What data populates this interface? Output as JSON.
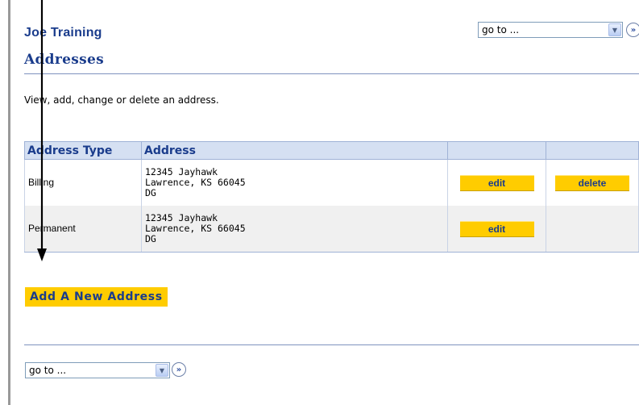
{
  "header": {
    "student_name": "Joe Training",
    "page_title": "Addresses"
  },
  "intro_text": "View, add, change or delete an address.",
  "top_nav": {
    "select_value": "go to ...",
    "go_symbol": "»"
  },
  "bottom_nav": {
    "select_value": "go to ...",
    "go_symbol": "»"
  },
  "table": {
    "columns": [
      "Address Type",
      "Address",
      "",
      ""
    ],
    "rows": [
      {
        "type": "Billing",
        "address_lines": [
          "12345 Jayhawk",
          "Lawrence, KS 66045",
          "DG"
        ],
        "edit_label": "edit",
        "delete_label": "delete"
      },
      {
        "type": "Permanent",
        "address_lines": [
          "12345 Jayhawk",
          "Lawrence, KS 66045",
          "DG"
        ],
        "edit_label": "edit"
      }
    ]
  },
  "add_button_label": "Add A New Address",
  "colors": {
    "brand_blue": "#1a3c8c",
    "button_yellow": "#ffcc00",
    "header_bg": "#d5e0f2"
  }
}
